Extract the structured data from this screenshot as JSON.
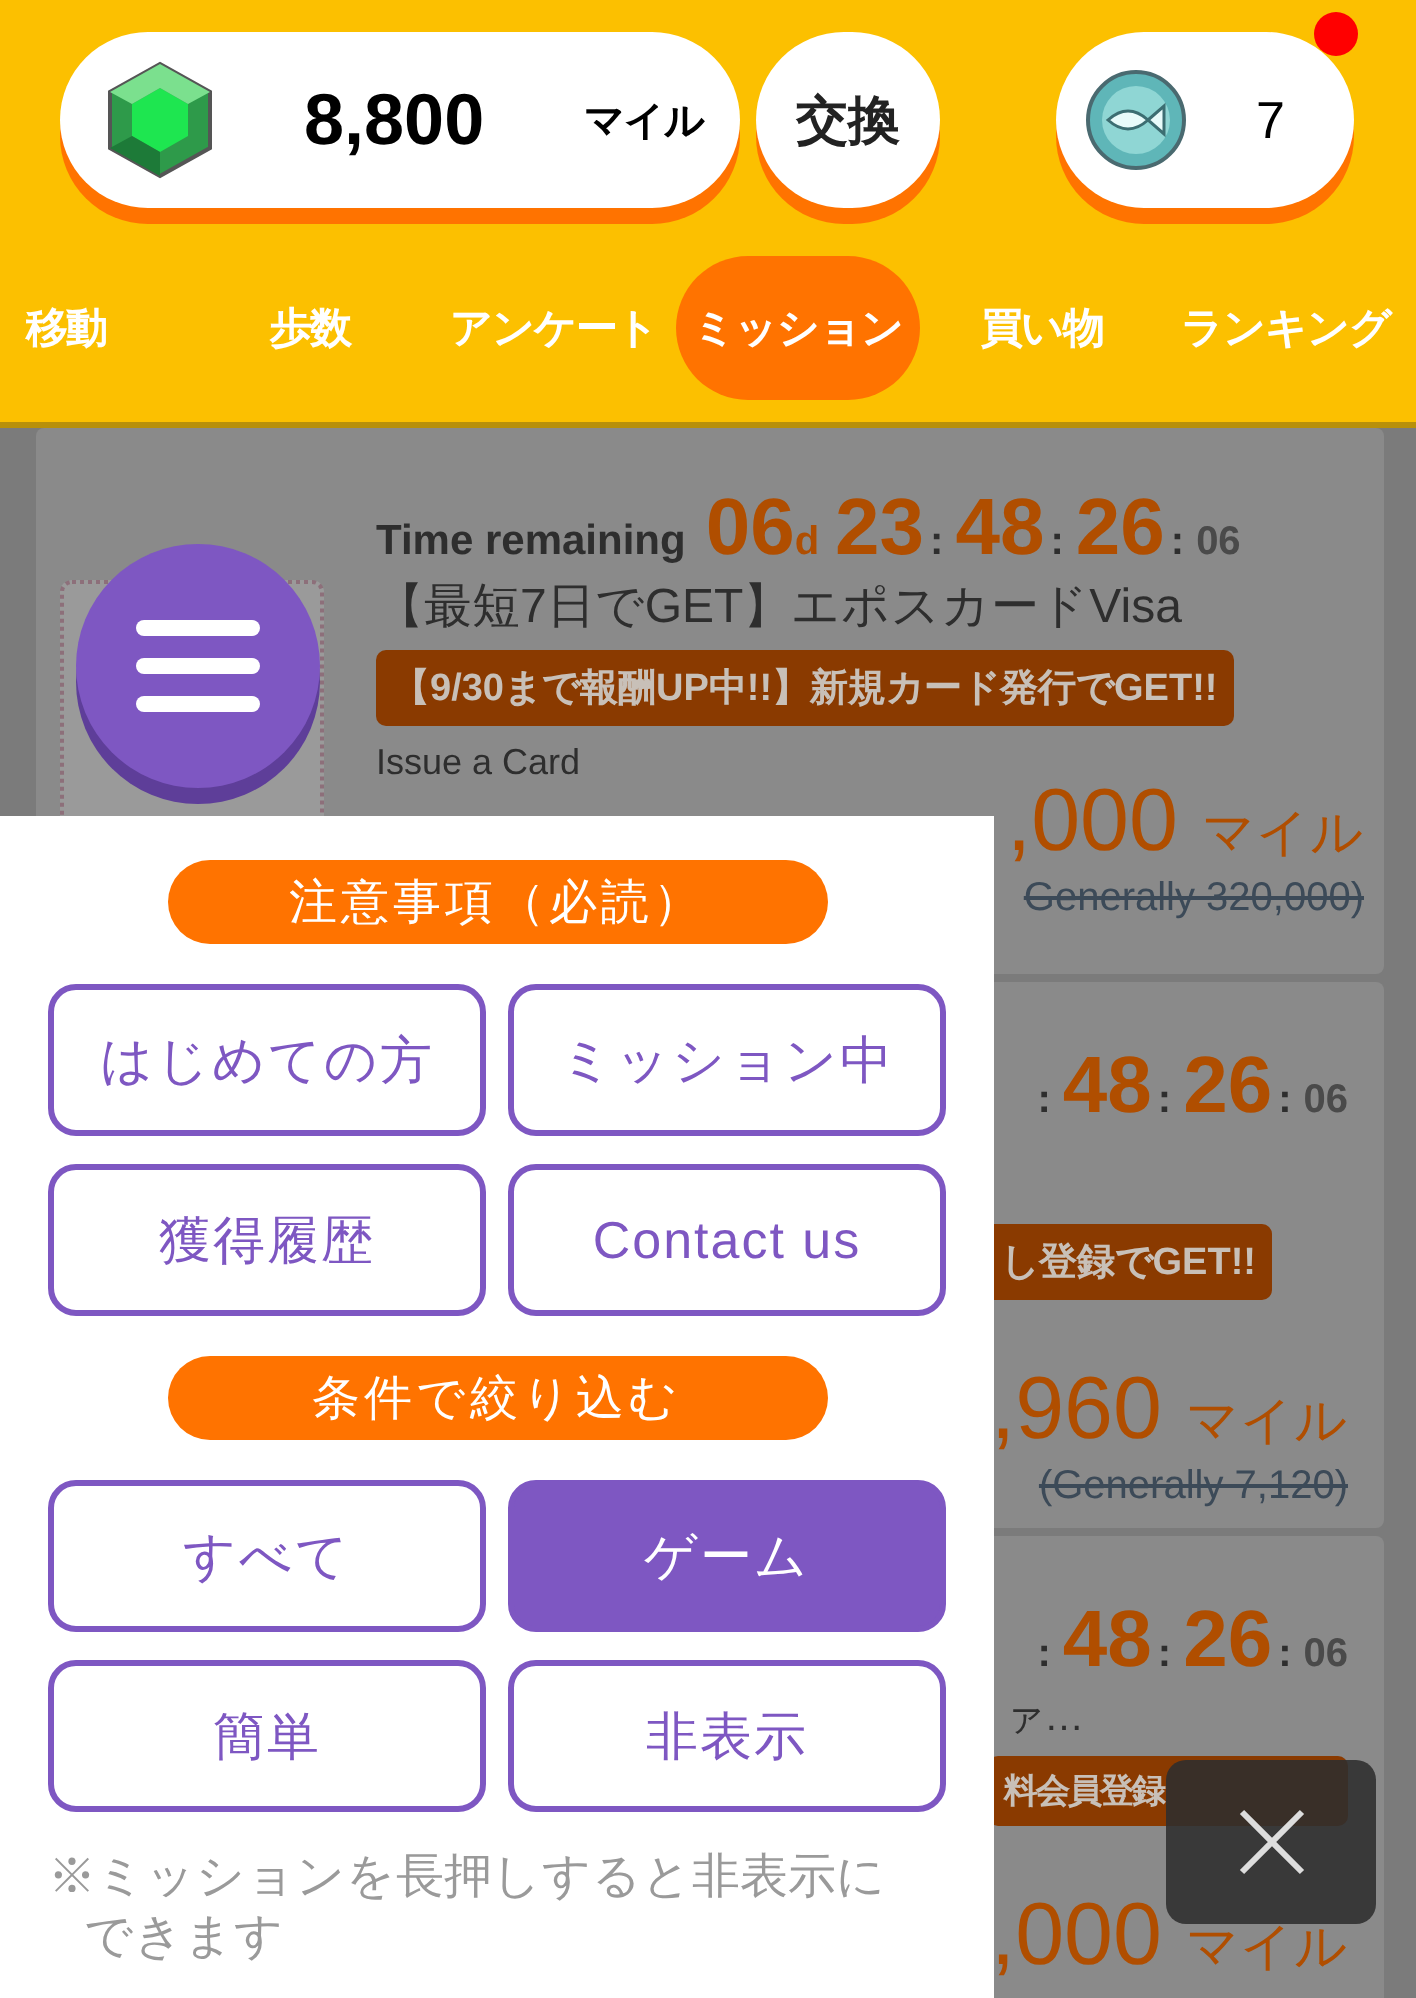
{
  "header": {
    "miles": "8,800",
    "miles_unit": "マイル",
    "exchange": "交換",
    "coins": "7",
    "has_notification": true
  },
  "tabs": [
    {
      "label": "移動",
      "selected": false
    },
    {
      "label": "歩数",
      "selected": false
    },
    {
      "label": "アンケート",
      "selected": false
    },
    {
      "label": "ミッション",
      "selected": true
    },
    {
      "label": "買い物",
      "selected": false
    },
    {
      "label": "ランキング",
      "selected": false
    }
  ],
  "missions": [
    {
      "kind": "full",
      "timer": [
        {
          "kind": "label",
          "text": "Time remaining"
        },
        {
          "kind": "big",
          "text": "06"
        },
        {
          "kind": "unit",
          "text": "d"
        },
        {
          "kind": "big",
          "text": "23"
        },
        {
          "kind": "sep",
          "text": ":"
        },
        {
          "kind": "big",
          "text": "48"
        },
        {
          "kind": "sep",
          "text": ":"
        },
        {
          "kind": "big",
          "text": "26"
        },
        {
          "kind": "sep",
          "text": ":"
        },
        {
          "kind": "small",
          "text": "06"
        }
      ],
      "title": "【最短7日でGET】エポスカードVisa",
      "tag": "【9/30まで報酬UP中!!】新規カード発行でGET!!",
      "subtitle": "Issue a Card",
      "miles": ",000",
      "miles_unit": "マイル",
      "generally": "Generally 320,000)"
    },
    {
      "kind": "partial",
      "timer": [
        {
          "kind": "sep",
          "text": ":"
        },
        {
          "kind": "big",
          "text": "48"
        },
        {
          "kind": "sep",
          "text": ":"
        },
        {
          "kind": "big",
          "text": "26"
        },
        {
          "kind": "sep",
          "text": ":"
        },
        {
          "kind": "small",
          "text": "06"
        }
      ],
      "tag": "し登録でGET!!",
      "miles": ",960",
      "miles_unit": "マイル",
      "generally": "(Generally 7,120)"
    },
    {
      "kind": "partial",
      "timer": [
        {
          "kind": "sep",
          "text": ":"
        },
        {
          "kind": "big",
          "text": "48"
        },
        {
          "kind": "sep",
          "text": ":"
        },
        {
          "kind": "big",
          "text": "26"
        },
        {
          "kind": "sep",
          "text": ":"
        },
        {
          "kind": "small",
          "text": "06"
        }
      ],
      "title": "ァ…",
      "tag": "料会員登録",
      "miles": ",000",
      "miles_unit": "マイル"
    }
  ],
  "menu": {
    "sections": [
      {
        "title": "注意事項（必読）",
        "buttons": [
          {
            "label": "はじめての方"
          },
          {
            "label": "ミッション中"
          },
          {
            "label": "獲得履歴"
          },
          {
            "label": "Contact us"
          }
        ]
      },
      {
        "title": "条件で絞り込む",
        "buttons": [
          {
            "label": "すべて",
            "selected": false
          },
          {
            "label": "ゲーム",
            "selected": true
          },
          {
            "label": "簡単",
            "selected": false
          },
          {
            "label": "非表示",
            "selected": false
          }
        ]
      }
    ],
    "note": "※ミッションを長押しすると非表示にできます"
  }
}
